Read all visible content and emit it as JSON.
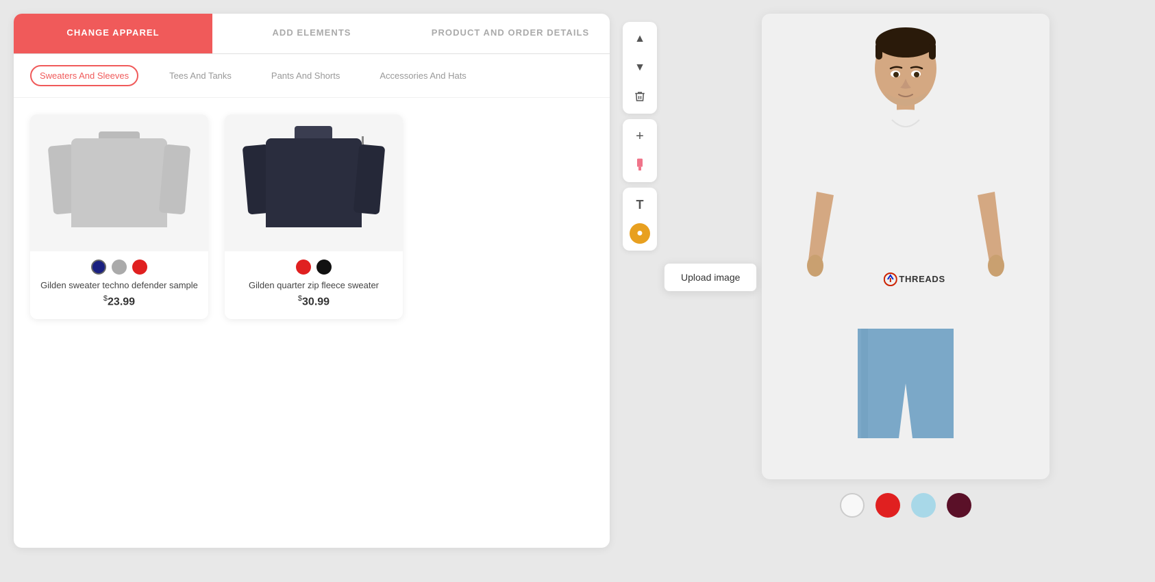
{
  "tabs": [
    {
      "id": "change-apparel",
      "label": "CHANGE APPAREL",
      "active": true
    },
    {
      "id": "add-elements",
      "label": "ADD ELEMENTS",
      "active": false
    },
    {
      "id": "product-order",
      "label": "PRODUCT AND ORDER DETAILS",
      "active": false
    }
  ],
  "categories": [
    {
      "id": "sweaters",
      "label": "Sweaters And Sleeves",
      "active": true
    },
    {
      "id": "tees",
      "label": "Tees And Tanks",
      "active": false
    },
    {
      "id": "pants",
      "label": "Pants And Shorts",
      "active": false
    },
    {
      "id": "accessories",
      "label": "Accessories And Hats",
      "active": false
    }
  ],
  "products": [
    {
      "id": "gilden-sweater",
      "name": "Gilden sweater techno defender sample",
      "price": "23.99",
      "currency": "$",
      "colors": [
        {
          "hex": "#1a2080",
          "selected": true
        },
        {
          "hex": "#aaaaaa",
          "selected": false
        },
        {
          "hex": "#e02020",
          "selected": false
        }
      ]
    },
    {
      "id": "gilden-quarter-zip",
      "name": "Gilden quarter zip fleece sweater",
      "price": "30.99",
      "currency": "$",
      "colors": [
        {
          "hex": "#e02020",
          "selected": false
        },
        {
          "hex": "#111111",
          "selected": false
        }
      ]
    }
  ],
  "toolbar": {
    "up_icon": "▲",
    "down_icon": "▼",
    "delete_icon": "🗑",
    "add_icon": "+",
    "image_icon": "📎",
    "text_icon": "T",
    "color_icon": "●",
    "upload_label": "Upload image"
  },
  "preview": {
    "brand_text": "THREADS",
    "shirt_colors": [
      {
        "name": "white",
        "hex": "#f8f8f8"
      },
      {
        "name": "red",
        "hex": "#e02020"
      },
      {
        "name": "light-blue",
        "hex": "#a8d8e8"
      },
      {
        "name": "dark-red",
        "hex": "#5a1028"
      }
    ]
  }
}
